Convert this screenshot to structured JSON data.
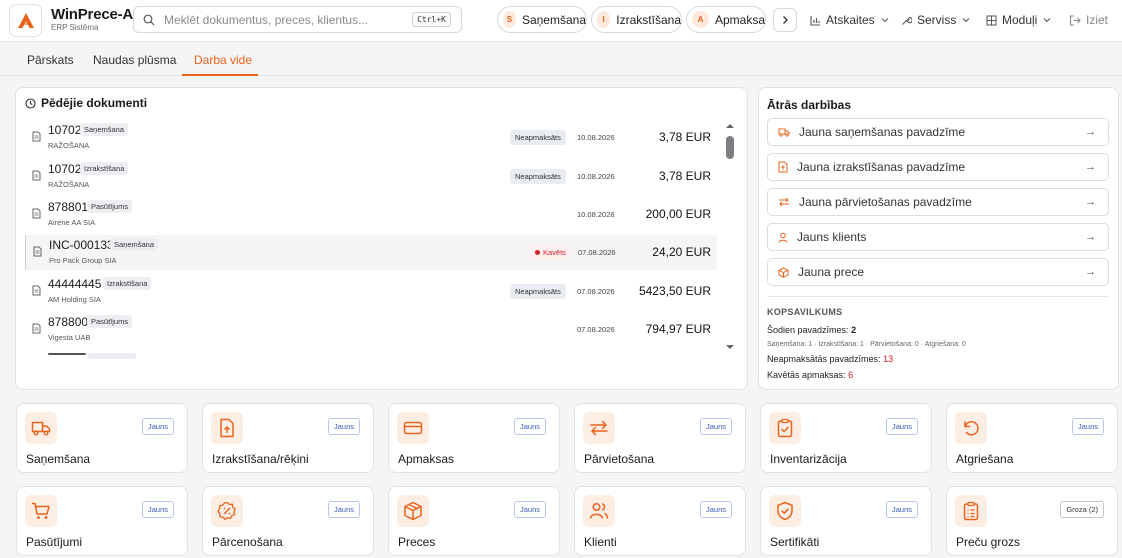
{
  "header": {
    "app_title": "WinPrece-A",
    "app_subtitle": "ERP Sistēma",
    "search_placeholder": "Meklēt dokumentus, preces, klientus...",
    "search_shortcut": "Ctrl+K",
    "quick_pills": [
      {
        "letter": "S",
        "label": "Saņemšana"
      },
      {
        "letter": "I",
        "label": "Izrakstīšana"
      },
      {
        "letter": "A",
        "label": "Apmaksa"
      }
    ],
    "menu": {
      "reports": "Atskaites",
      "service": "Serviss",
      "modules": "Moduļi",
      "exit": "Iziet"
    }
  },
  "tabs": [
    "Pārskats",
    "Naudas plūsma",
    "Darba vide"
  ],
  "active_tab": "Darba vide",
  "recent_docs": {
    "title": "Pēdējie dokumenti",
    "rows": [
      {
        "num": "10702",
        "type": "Saņemšana",
        "party": "RAŽOŠANA",
        "status": "Neapmaksāts",
        "date": "10.08.2026",
        "amount": "3,78 EUR"
      },
      {
        "num": "10702",
        "type": "Izrakstīšana",
        "party": "RAŽOŠANA",
        "status": "Neapmaksāts",
        "date": "10.08.2026",
        "amount": "3,78 EUR"
      },
      {
        "num": "878801",
        "type": "Pasūtījums",
        "party": "Airene AA SIA",
        "status": "",
        "date": "10.08.2026",
        "amount": "200,00 EUR"
      },
      {
        "num": "INC-000133",
        "type": "Saņemšana",
        "party": "Pro Pack Group SIA",
        "status": "Kavēts",
        "date": "07.08.2026",
        "amount": "24,20 EUR"
      },
      {
        "num": "44444445",
        "type": "Izrakstīšana",
        "party": "AM Holding SIA",
        "status": "Neapmaksāts",
        "date": "07.08.2026",
        "amount": "5423,50 EUR"
      },
      {
        "num": "878800",
        "type": "Pasūtījums",
        "party": "Vigesta UAB",
        "status": "",
        "date": "07.08.2026",
        "amount": "794,97 EUR"
      }
    ]
  },
  "quick_actions": {
    "title": "Ātrās darbības",
    "items": [
      {
        "icon": "truck-icon",
        "label": "Jauna saņemšanas pavadzīme"
      },
      {
        "icon": "invoice-icon",
        "label": "Jauna izrakstīšanas pavadzīme"
      },
      {
        "icon": "transfer-icon",
        "label": "Jauna pārvietošanas pavadzīme"
      },
      {
        "icon": "user-icon",
        "label": "Jauns klients"
      },
      {
        "icon": "box-icon",
        "label": "Jauna prece"
      }
    ],
    "arrow": "→"
  },
  "summary": {
    "title": "KOPSAVILKUMS",
    "today_label": "Šodien pavadzīmes:",
    "today_value": "2",
    "breakdown": "Saņemšana: 1 · Izrakstīšana: 1 · Pārvietošana: 0 · Atgriešana: 0",
    "unpaid_label": "Neapmaksātās pavadzīmes:",
    "unpaid_value": "13",
    "late_label": "Kavētās apmaksas:",
    "late_value": "6"
  },
  "tiles": [
    {
      "icon": "truck-icon",
      "label": "Saņemšana",
      "badge": "Jauns"
    },
    {
      "icon": "invoice-icon",
      "label": "Izrakstīšana/rēķini",
      "badge": "Jauns"
    },
    {
      "icon": "card-icon",
      "label": "Apmaksas",
      "badge": "Jauns"
    },
    {
      "icon": "transfer-icon",
      "label": "Pārvietošana",
      "badge": "Jauns"
    },
    {
      "icon": "clipboard-check-icon",
      "label": "Inventarizācija",
      "badge": "Jauns"
    },
    {
      "icon": "undo-icon",
      "label": "Atgriešana",
      "badge": "Jauns"
    },
    {
      "icon": "cart-icon",
      "label": "Pasūtījumi",
      "badge": "Jauns"
    },
    {
      "icon": "percent-badge-icon",
      "label": "Pārcenošana",
      "badge": "Jauns"
    },
    {
      "icon": "box-icon",
      "label": "Preces",
      "badge": "Jauns"
    },
    {
      "icon": "users-icon",
      "label": "Klienti",
      "badge": "Jauns"
    },
    {
      "icon": "shield-check-icon",
      "label": "Sertifikāti",
      "badge": "Jauns"
    },
    {
      "icon": "clipboard-list-icon",
      "label": "Preču grozs",
      "badge": "Groza (2)"
    }
  ],
  "colors": {
    "accent": "#e8631c",
    "danger": "#d4202c"
  }
}
